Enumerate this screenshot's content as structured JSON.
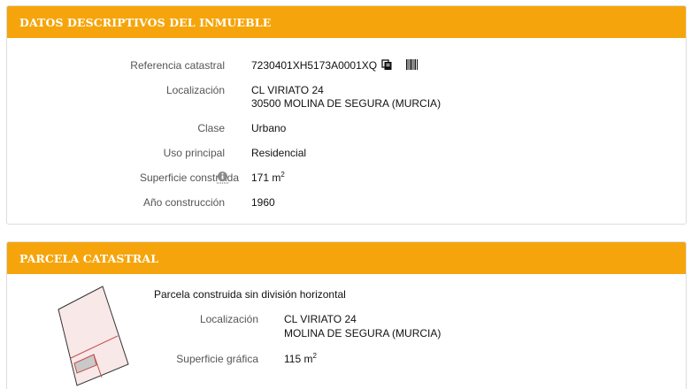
{
  "inmueble": {
    "title": "DATOS DESCRIPTIVOS DEL INMUEBLE",
    "fields": {
      "ref_label": "Referencia catastral",
      "ref_value": "7230401XH5173A0001XQ",
      "loc_label": "Localización",
      "loc_line1": "CL VIRIATO 24",
      "loc_line2": "30500 MOLINA DE SEGURA (MURCIA)",
      "clase_label": "Clase",
      "clase_value": "Urbano",
      "uso_label": "Uso principal",
      "uso_value": "Residencial",
      "sup_label": "Superficie construida",
      "sup_value": "171 m",
      "sup_exp": "2",
      "anio_label": "Año construcción",
      "anio_value": "1960"
    },
    "icons": [
      "copy-icon",
      "barcode-icon",
      "info-icon"
    ]
  },
  "parcela": {
    "title": "PARCELA CATASTRAL",
    "subtitle": "Parcela construida sin división horizontal",
    "loc_label": "Localización",
    "loc_line1": "CL VIRIATO 24",
    "loc_line2": "MOLINA DE SEGURA (MURCIA)",
    "sup_label": "Superficie gráfica",
    "sup_value": "115 m",
    "sup_exp": "2"
  },
  "colors": {
    "header": "#f5a50b",
    "parcel_fill": "#f7e6e6",
    "parcel_stroke": "#c0504d",
    "hatched": "#c9c9c9"
  }
}
